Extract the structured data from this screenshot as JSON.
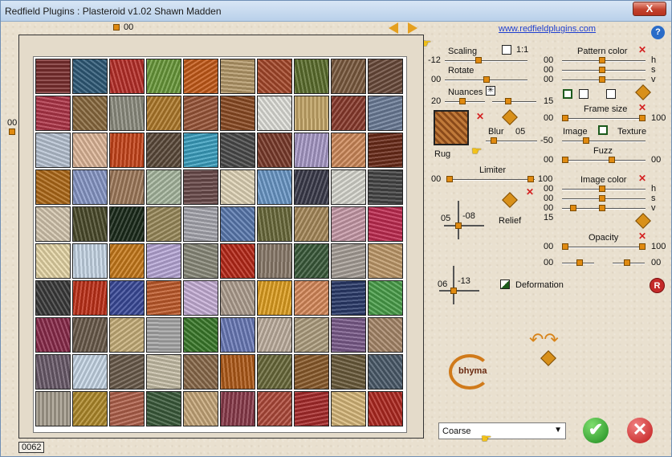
{
  "window": {
    "title": "Redfield Plugins : Plasteroid v1.02   Shawn Madden",
    "close_label": "X"
  },
  "header": {
    "top_counter": "00",
    "left_counter": "00",
    "link": "www.redfieldplugins.com",
    "help": "?"
  },
  "grid": {
    "footer_counter": "0062",
    "tiles": [
      "#7b2f2f",
      "#2f5a78",
      "#b82e28",
      "#6a9a3a",
      "#c65a18",
      "#b69a6a",
      "#a6482a",
      "#5b6e2c",
      "#7b5a3e",
      "#6a4a3a",
      "#b03548",
      "#8a6a3e",
      "#8e8e80",
      "#b07a2a",
      "#9a5638",
      "#8b4a22",
      "#e2e2dc",
      "#c7a868",
      "#8a3a2c",
      "#6c7d98",
      "#b8c4d4",
      "#e0b89a",
      "#c8441a",
      "#5c4a3a",
      "#3aa0c0",
      "#4a4a4a",
      "#7a3a2a",
      "#a89ac8",
      "#d08a5a",
      "#6a2a18",
      "#b06a18",
      "#8898c8",
      "#a07a5a",
      "#a8b8a0",
      "#6a4a4a",
      "#e2d6b8",
      "#6a98c8",
      "#3a3a4a",
      "#d8d8d0",
      "#444",
      "#d6c8b0",
      "#4a4a2a",
      "#1a2a1a",
      "#9a8a5a",
      "#a8a8b0",
      "#5a7ab0",
      "#6a6a3a",
      "#a88a5a",
      "#c89aa8",
      "#c02a50",
      "#e8d8a8",
      "#c8d8e8",
      "#c87a1a",
      "#b8a8d8",
      "#8a8a7a",
      "#b82818",
      "#8a7a6a",
      "#3a5a3a",
      "#a8a098",
      "#c09a6a",
      "#3a3a3a",
      "#c03018",
      "#3a4a9a",
      "#c05a2a",
      "#c8b0d8",
      "#b0a090",
      "#e0a020",
      "#d88a5a",
      "#2a3a6a",
      "#4aa04a",
      "#8a2a4a",
      "#6a5a4a",
      "#c8b07a",
      "#a8a8a8",
      "#3a7a2a",
      "#6a7ab8",
      "#c0b0a0",
      "#b0a080",
      "#7a5a8a",
      "#a8886a",
      "#6a5a6a",
      "#c8d8e8",
      "#6a5a4a",
      "#c8c0a8",
      "#8a6a4a",
      "#b05a18",
      "#6a6a3a",
      "#8a5a2a",
      "#6a5a3a",
      "#4a5a6a",
      "#a8a090",
      "#b08a2a",
      "#b0604a",
      "#3a5a3a",
      "#c8a87a",
      "#8a3a4a",
      "#b04a3a",
      "#a82a2a",
      "#d8b87a",
      "#b02820"
    ]
  },
  "controls": {
    "scaling": "Scaling",
    "one_to_one": "1:1",
    "scaling_val": "-12",
    "rotate": "Rotate",
    "rotate_val": "00",
    "nuances": "Nuances",
    "nuances_left": "20",
    "nuances_right": "15",
    "pattern_color": "Pattern color",
    "pc_h": "00",
    "pc_s": "00",
    "pc_v": "00",
    "h": "h",
    "s": "s",
    "v": "v",
    "frame_size": "Frame size",
    "frame_left": "00",
    "frame_right": "100",
    "texture_name": "Rug",
    "blur": "Blur",
    "blur_val": "05",
    "image": "Image",
    "texture": "Texture",
    "image_tex_val": "-50",
    "fuzz": "Fuzz",
    "fuzz_left": "00",
    "fuzz_right": "00",
    "limiter": "Limiter",
    "limiter_left": "00",
    "limiter_right": "100",
    "image_color": "Image color",
    "ic_h": "00",
    "ic_s": "00",
    "ic_v": "00",
    "ic_15": "15",
    "relief": "Relief",
    "relief_a": "05",
    "relief_b": "-08",
    "opacity": "Opacity",
    "op_left": "00",
    "op_right": "100",
    "op2_left": "00",
    "op2_right": "00",
    "deformation": "Deformation",
    "def_a": "06",
    "def_b": "-13",
    "logo": "bhyma",
    "select_value": "Coarse",
    "ok_symbol": "✔",
    "cancel_symbol": "✕",
    "reset_symbol": "R"
  },
  "colors": {
    "accent": "#e08a10",
    "ok": "#2ea02e",
    "cancel": "#d22a2a"
  }
}
